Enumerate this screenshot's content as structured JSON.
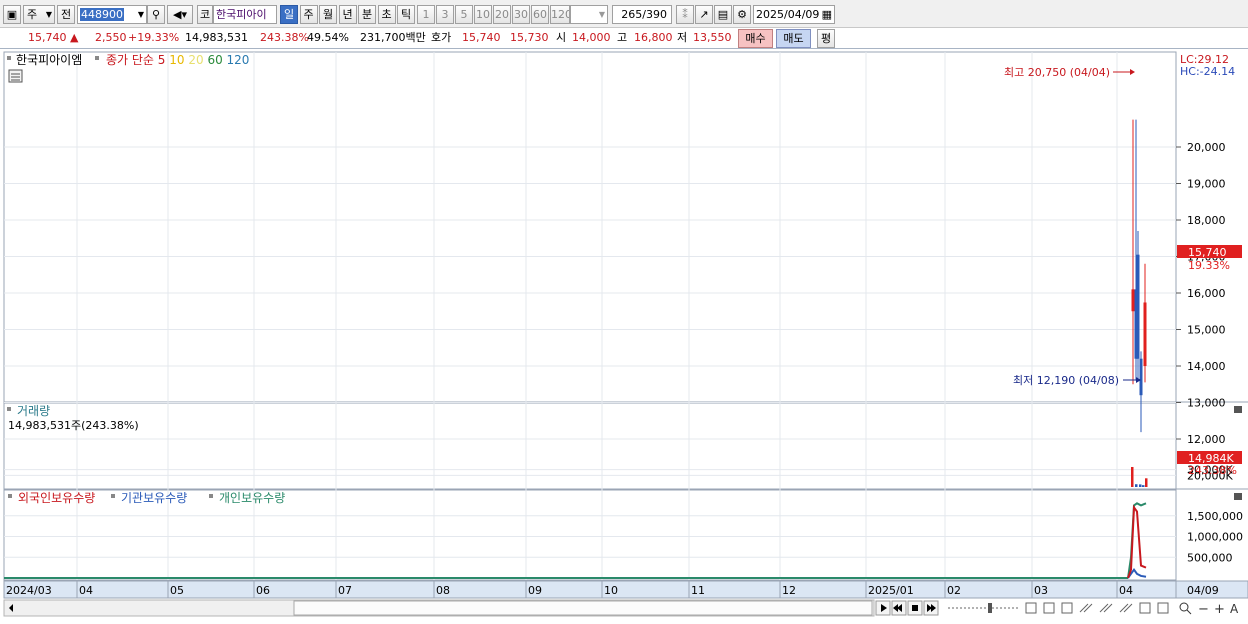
{
  "toolbar": {
    "market": "주",
    "prev_label": "전",
    "code": "448900",
    "ko_label": "코",
    "stock_name": "한국피아이",
    "periods": [
      "일",
      "주",
      "월",
      "년",
      "분",
      "초",
      "틱"
    ],
    "numbers": [
      "1",
      "3",
      "5",
      "10",
      "20",
      "30",
      "60",
      "120"
    ],
    "count_current": "265",
    "count_total": "/390",
    "date": "2025/04/09"
  },
  "quote": {
    "price": "15,740",
    "change": "2,550",
    "change_pct": "+19.33%",
    "volume": "14,983,531",
    "volume_ratio": "243.38%",
    "turnover": "49.54%",
    "amount": "231,700백만",
    "hoga_label": "호가",
    "ask": "15,740",
    "bid": "15,730",
    "open_label": "시",
    "open": "14,000",
    "high_label": "고",
    "high": "16,800",
    "low_label": "저",
    "low": "13,550",
    "buy_label": "매수",
    "sell_label": "매도",
    "extra_label": "평"
  },
  "price_panel": {
    "name": "한국피아이엠",
    "indicator_label": "종가 단순",
    "ma_periods": [
      {
        "label": "5",
        "color": "#c8181e"
      },
      {
        "label": "10",
        "color": "#e8b800"
      },
      {
        "label": "20",
        "color": "#e8e070"
      },
      {
        "label": "60",
        "color": "#2a8a3a"
      },
      {
        "label": "120",
        "color": "#2a7ab0"
      }
    ],
    "lc": "LC:29.12",
    "hc": "HC:-24.14",
    "y_ticks": [
      "20,000",
      "19,000",
      "18,000",
      "17,000",
      "16,000",
      "15,000",
      "14,000",
      "13,000",
      "12,000"
    ],
    "current_price_tag": "15,740",
    "current_pct_tag": "19.33%",
    "high_note": "최고 20,750 (04/04)",
    "low_note": "최저 12,190 (04/08)"
  },
  "volume_panel": {
    "title": "거래량",
    "value_text": "14,983,531주(243.38%)",
    "y_ticks": [
      "30,000K",
      "20,000K"
    ],
    "current_tag": "14,984K",
    "current_pct": "243.38%"
  },
  "holding_panel": {
    "legend": [
      {
        "label": "외국인보유수량",
        "color": "#c8181e"
      },
      {
        "label": "기관보유수량",
        "color": "#2a5ab8"
      },
      {
        "label": "개인보유수량",
        "color": "#2a8a6a"
      }
    ],
    "y_ticks": [
      "1,500,000",
      "1,000,000",
      "500,000"
    ]
  },
  "x_axis": [
    "2024/03",
    "04",
    "05",
    "06",
    "07",
    "08",
    "09",
    "10",
    "11",
    "12",
    "2025/01",
    "02",
    "03",
    "04",
    "04/09"
  ],
  "chart_data": {
    "type": "candlestick",
    "candles": [
      {
        "date": "04/03",
        "open": 15500,
        "high": 20750,
        "low": 13500,
        "close": 16100,
        "color": "up"
      },
      {
        "date": "04/04",
        "open": 16100,
        "high": 20750,
        "low": 13600,
        "close": 14200,
        "color": "down"
      },
      {
        "date": "04/07",
        "open": 14200,
        "high": 17700,
        "low": 13600,
        "close": 17050,
        "color": "down"
      },
      {
        "date": "04/08",
        "open": 14200,
        "high": 14400,
        "low": 12190,
        "close": 13200,
        "color": "down"
      },
      {
        "date": "04/09",
        "open": 14000,
        "high": 16800,
        "low": 13550,
        "close": 15740,
        "color": "up"
      }
    ],
    "volume_k": [
      34500,
      4800,
      4500,
      3200,
      14984
    ],
    "holdings": {
      "foreign": [
        0,
        200000,
        1700000,
        1600000,
        300000,
        250000
      ],
      "institution": [
        0,
        100000,
        200000,
        100000,
        50000,
        30000
      ],
      "individual": [
        0,
        500000,
        1750000,
        1800000,
        1750000,
        1800000
      ]
    },
    "price_ylim": [
      11700,
      20800
    ]
  }
}
